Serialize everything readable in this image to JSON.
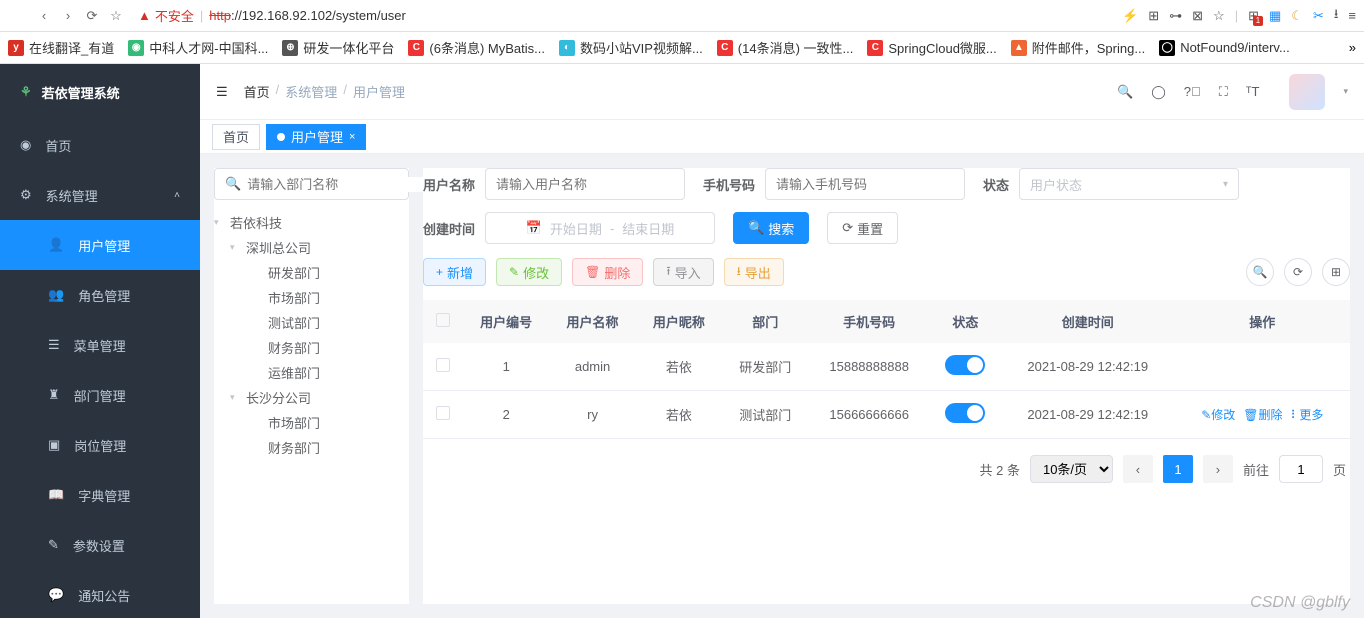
{
  "browser": {
    "insecure_label": "不安全",
    "url_http": "http",
    "url_rest": "://192.168.92.102/system/user"
  },
  "bookmarks": [
    {
      "label": "在线翻译_有道",
      "bg": "#d93025",
      "txt": "y"
    },
    {
      "label": "中科人才网-中国科...",
      "bg": "#3b7",
      "txt": "◉"
    },
    {
      "label": "研发一体化平台",
      "bg": "#555",
      "txt": "⊕"
    },
    {
      "label": "(6条消息) MyBatis...",
      "bg": "#e33",
      "txt": "C"
    },
    {
      "label": "数码小站VIP视频解...",
      "bg": "#3bd",
      "txt": "◐"
    },
    {
      "label": "(14条消息) 一致性...",
      "bg": "#e33",
      "txt": "C"
    },
    {
      "label": "SpringCloud微服...",
      "bg": "#e33",
      "txt": "C"
    },
    {
      "label": "附件邮件，Spring...",
      "bg": "#e63",
      "txt": "▲"
    },
    {
      "label": "NotFound9/interv...",
      "bg": "#000",
      "txt": "◯"
    }
  ],
  "sidebar": {
    "app_name": "若依管理系统",
    "items": [
      {
        "label": "首页",
        "icon": "◉"
      },
      {
        "label": "系统管理",
        "icon": "⚙",
        "submenu": true,
        "open": true
      },
      {
        "label": "用户管理",
        "icon": "👤",
        "sub": true,
        "active": true
      },
      {
        "label": "角色管理",
        "icon": "👥",
        "sub": true
      },
      {
        "label": "菜单管理",
        "icon": "☰",
        "sub": true
      },
      {
        "label": "部门管理",
        "icon": "♜",
        "sub": true
      },
      {
        "label": "岗位管理",
        "icon": "▣",
        "sub": true
      },
      {
        "label": "字典管理",
        "icon": "📖",
        "sub": true
      },
      {
        "label": "参数设置",
        "icon": "✎",
        "sub": true
      },
      {
        "label": "通知公告",
        "icon": "💬",
        "sub": true
      }
    ]
  },
  "header": {
    "crumb_home": "首页",
    "crumb1": "系统管理",
    "crumb2": "用户管理"
  },
  "tabs": [
    {
      "label": "首页",
      "active": false
    },
    {
      "label": "用户管理",
      "active": true
    }
  ],
  "dept_search_placeholder": "请输入部门名称",
  "dept_tree": [
    {
      "label": "若依科技",
      "level": 0,
      "expand": true
    },
    {
      "label": "深圳总公司",
      "level": 1,
      "expand": true
    },
    {
      "label": "研发部门",
      "level": 2
    },
    {
      "label": "市场部门",
      "level": 2
    },
    {
      "label": "测试部门",
      "level": 2
    },
    {
      "label": "财务部门",
      "level": 2
    },
    {
      "label": "运维部门",
      "level": 2
    },
    {
      "label": "长沙分公司",
      "level": 1,
      "expand": true
    },
    {
      "label": "市场部门",
      "level": 2
    },
    {
      "label": "财务部门",
      "level": 2
    }
  ],
  "form": {
    "user_name_label": "用户名称",
    "user_name_ph": "请输入用户名称",
    "phone_label": "手机号码",
    "phone_ph": "请输入手机号码",
    "status_label": "状态",
    "status_ph": "用户状态",
    "date_label": "创建时间",
    "date_start": "开始日期",
    "date_sep": "-",
    "date_end": "结束日期",
    "search_btn": "搜索",
    "reset_btn": "重置"
  },
  "actions": {
    "add": "新增",
    "edit": "修改",
    "delete": "删除",
    "import": "导入",
    "export": "导出"
  },
  "table": {
    "cols": [
      "用户编号",
      "用户名称",
      "用户昵称",
      "部门",
      "手机号码",
      "状态",
      "创建时间",
      "操作"
    ],
    "rows": [
      {
        "id": "1",
        "name": "admin",
        "nick": "若依",
        "dept": "研发部门",
        "phone": "15888888888",
        "time": "2021-08-29 12:42:19",
        "ops": false
      },
      {
        "id": "2",
        "name": "ry",
        "nick": "若依",
        "dept": "测试部门",
        "phone": "15666666666",
        "time": "2021-08-29 12:42:19",
        "ops": true
      }
    ],
    "op_edit": "修改",
    "op_delete": "删除",
    "op_more": "更多"
  },
  "pagination": {
    "total": "共 2 条",
    "per_page": "10条/页",
    "page": "1",
    "goto": "前往",
    "goto_suffix": "页"
  },
  "watermark": "CSDN @gblfy"
}
